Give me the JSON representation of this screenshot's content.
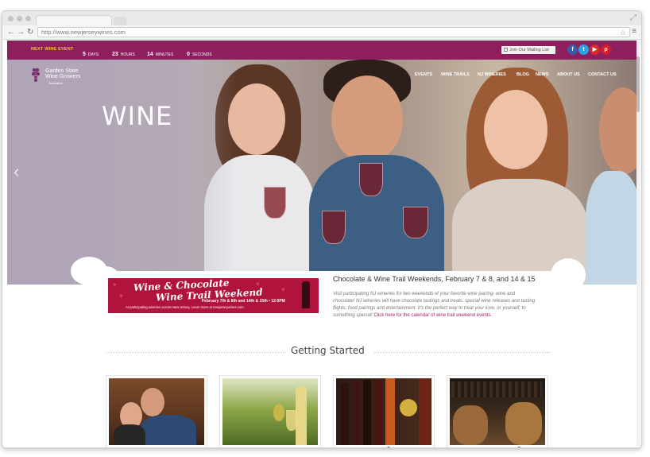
{
  "browser": {
    "url": "http://www.newjerseywines.com",
    "back_icon": "arrow-left-icon",
    "forward_icon": "arrow-right-icon",
    "reload_icon": "reload-icon",
    "bookmark_icon": "star-icon",
    "menu_icon": "hamburger-icon"
  },
  "topbar": {
    "next_event_label": "NEXT WINE EVENT",
    "countdown": [
      {
        "value": "5",
        "unit": "DAYS"
      },
      {
        "value": "23",
        "unit": "HOURS"
      },
      {
        "value": "14",
        "unit": "MINUTES"
      },
      {
        "value": "0",
        "unit": "SECONDS"
      }
    ],
    "mailing_label": "Join Our Mailing List",
    "social": [
      {
        "label": "f",
        "icon": "facebook-icon",
        "color": "#3b5ba5"
      },
      {
        "label": "t",
        "icon": "twitter-icon",
        "color": "#2aa3e5"
      },
      {
        "label": "▶",
        "icon": "youtube-icon",
        "color": "#d62b2b"
      },
      {
        "label": "p",
        "icon": "pinterest-icon",
        "color": "#cf1f2c"
      }
    ]
  },
  "logo": {
    "line1": "Garden State",
    "line2": "Wine Growers",
    "line3": "Association"
  },
  "nav": [
    "EVENTS",
    "WINE TRAILS",
    "NJ WINERIES",
    "BLOG",
    "NEWS",
    "ABOUT US",
    "CONTACT US"
  ],
  "hero": {
    "title": "WINE"
  },
  "banner": {
    "line1": "Wine & Chocolate",
    "line2": "Wine Trail Weekend",
    "dates": "February 7th & 8th and 14th & 15th • 12-5PM",
    "footer": "At participating wineries across New Jersey.  Learn more at newjerseywines.com"
  },
  "event": {
    "title": "Chocolate & Wine Trail Weekends, February 7 & 8, and 14 & 15",
    "description": "Visit participating NJ wineries for two weekends of your favorite wine pairing- wine and chocolate! NJ wineries will have chocolate tastings and treats, special wine releases and tasting flights, food pairings and entertainment. It's the perfect way to treat your love, or yourself, to something special! ",
    "link": "Click here for the calendar of wine trail weekend events."
  },
  "getting_started": {
    "title": "Getting Started"
  },
  "colors": {
    "brand": "#8e1f5e",
    "accent": "#f3c33d"
  }
}
